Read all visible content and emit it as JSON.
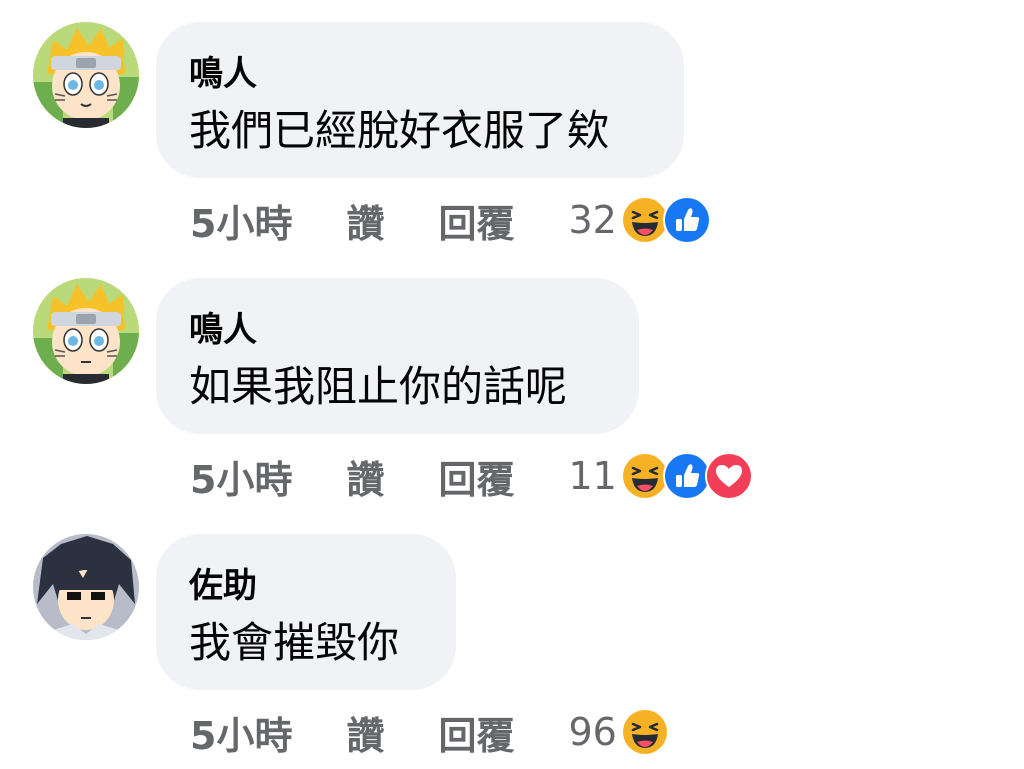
{
  "comments": [
    {
      "author": "鳴人",
      "text": "我們已經脫好衣服了欸",
      "time": "5小時",
      "like_label": "讚",
      "reply_label": "回覆",
      "reaction_count": "32",
      "reactions": [
        "haha",
        "like"
      ]
    },
    {
      "author": "鳴人",
      "text": "如果我阻止你的話呢",
      "time": "5小時",
      "like_label": "讚",
      "reply_label": "回覆",
      "reaction_count": "11",
      "reactions": [
        "haha",
        "like",
        "love"
      ]
    },
    {
      "author": "佐助",
      "text": "我會摧毀你",
      "time": "5小時",
      "like_label": "讚",
      "reply_label": "回覆",
      "reaction_count": "96",
      "reactions": [
        "haha"
      ]
    }
  ],
  "colors": {
    "bubble": "#f0f2f5",
    "meta_text": "#65676b",
    "like_blue": "#1877f2",
    "love_red": "#f33e58",
    "haha_yellow": "#f7b125"
  }
}
